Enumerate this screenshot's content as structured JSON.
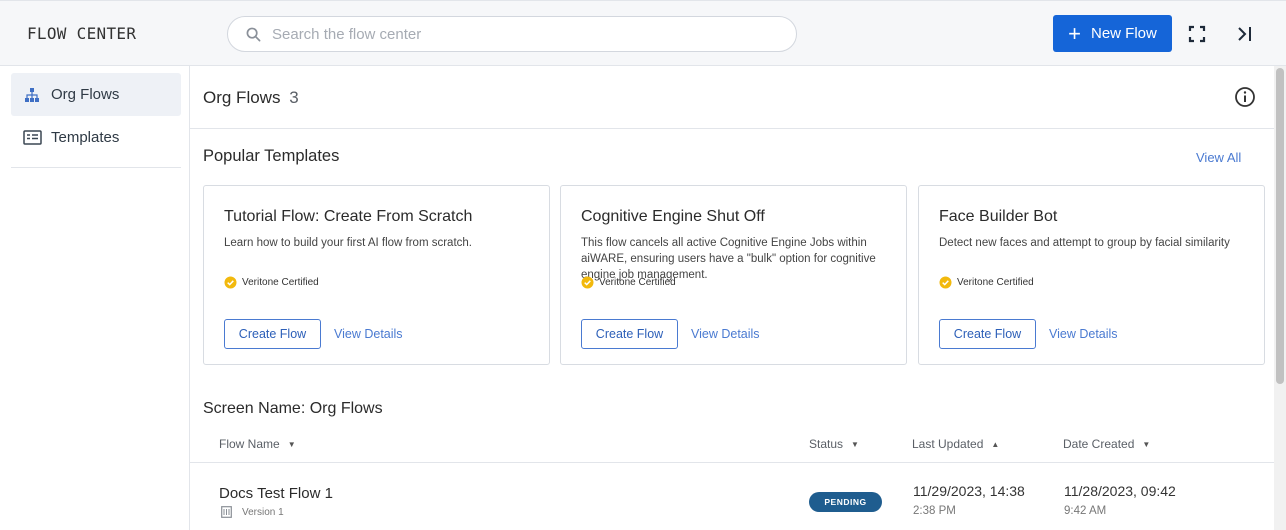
{
  "header": {
    "app_title": "FLOW CENTER",
    "search_placeholder": "Search the flow center",
    "new_flow_label": "New Flow",
    "icons": [
      "search-icon",
      "plus-icon",
      "fullscreen-icon",
      "collapse-panel-icon"
    ],
    "accent_color": "#1565d8"
  },
  "sidebar": {
    "items": [
      {
        "label": "Org Flows",
        "icon": "org-chart-icon",
        "active": true
      },
      {
        "label": "Templates",
        "icon": "template-icon",
        "active": false
      }
    ]
  },
  "main": {
    "org_title": "Org Flows",
    "org_count": "3",
    "popular_title": "Popular Templates",
    "view_all_label": "View All",
    "cards": [
      {
        "title": "Tutorial Flow: Create From Scratch",
        "description": "Learn how to build your first AI flow from scratch.",
        "certified_label": "Veritone Certified",
        "create_label": "Create Flow",
        "details_label": "View Details"
      },
      {
        "title": "Cognitive Engine Shut Off",
        "description": "This flow cancels all active Cognitive Engine Jobs within aiWARE, ensuring users have a \"bulk\" option for cognitive engine job management.",
        "certified_label": "Veritone Certified",
        "create_label": "Create Flow",
        "details_label": "View Details"
      },
      {
        "title": "Face Builder Bot",
        "description": "Detect new faces and attempt to group by facial similarity",
        "certified_label": "Veritone Certified",
        "create_label": "Create Flow",
        "details_label": "View Details"
      }
    ],
    "screen_name": "Screen Name: Org Flows",
    "table": {
      "columns": [
        "Flow Name",
        "Status",
        "Last Updated",
        "Date Created"
      ],
      "rows": [
        {
          "name": "Docs Test Flow 1",
          "version": "Version 1",
          "status": "PENDING",
          "last_updated_date": "11/29/2023, 14:38",
          "last_updated_time": "2:38 PM",
          "date_created_date": "11/28/2023, 09:42",
          "date_created_time": "9:42 AM"
        }
      ]
    },
    "status_color": "#1f5d8f",
    "certified_color": "#f2b90d"
  }
}
